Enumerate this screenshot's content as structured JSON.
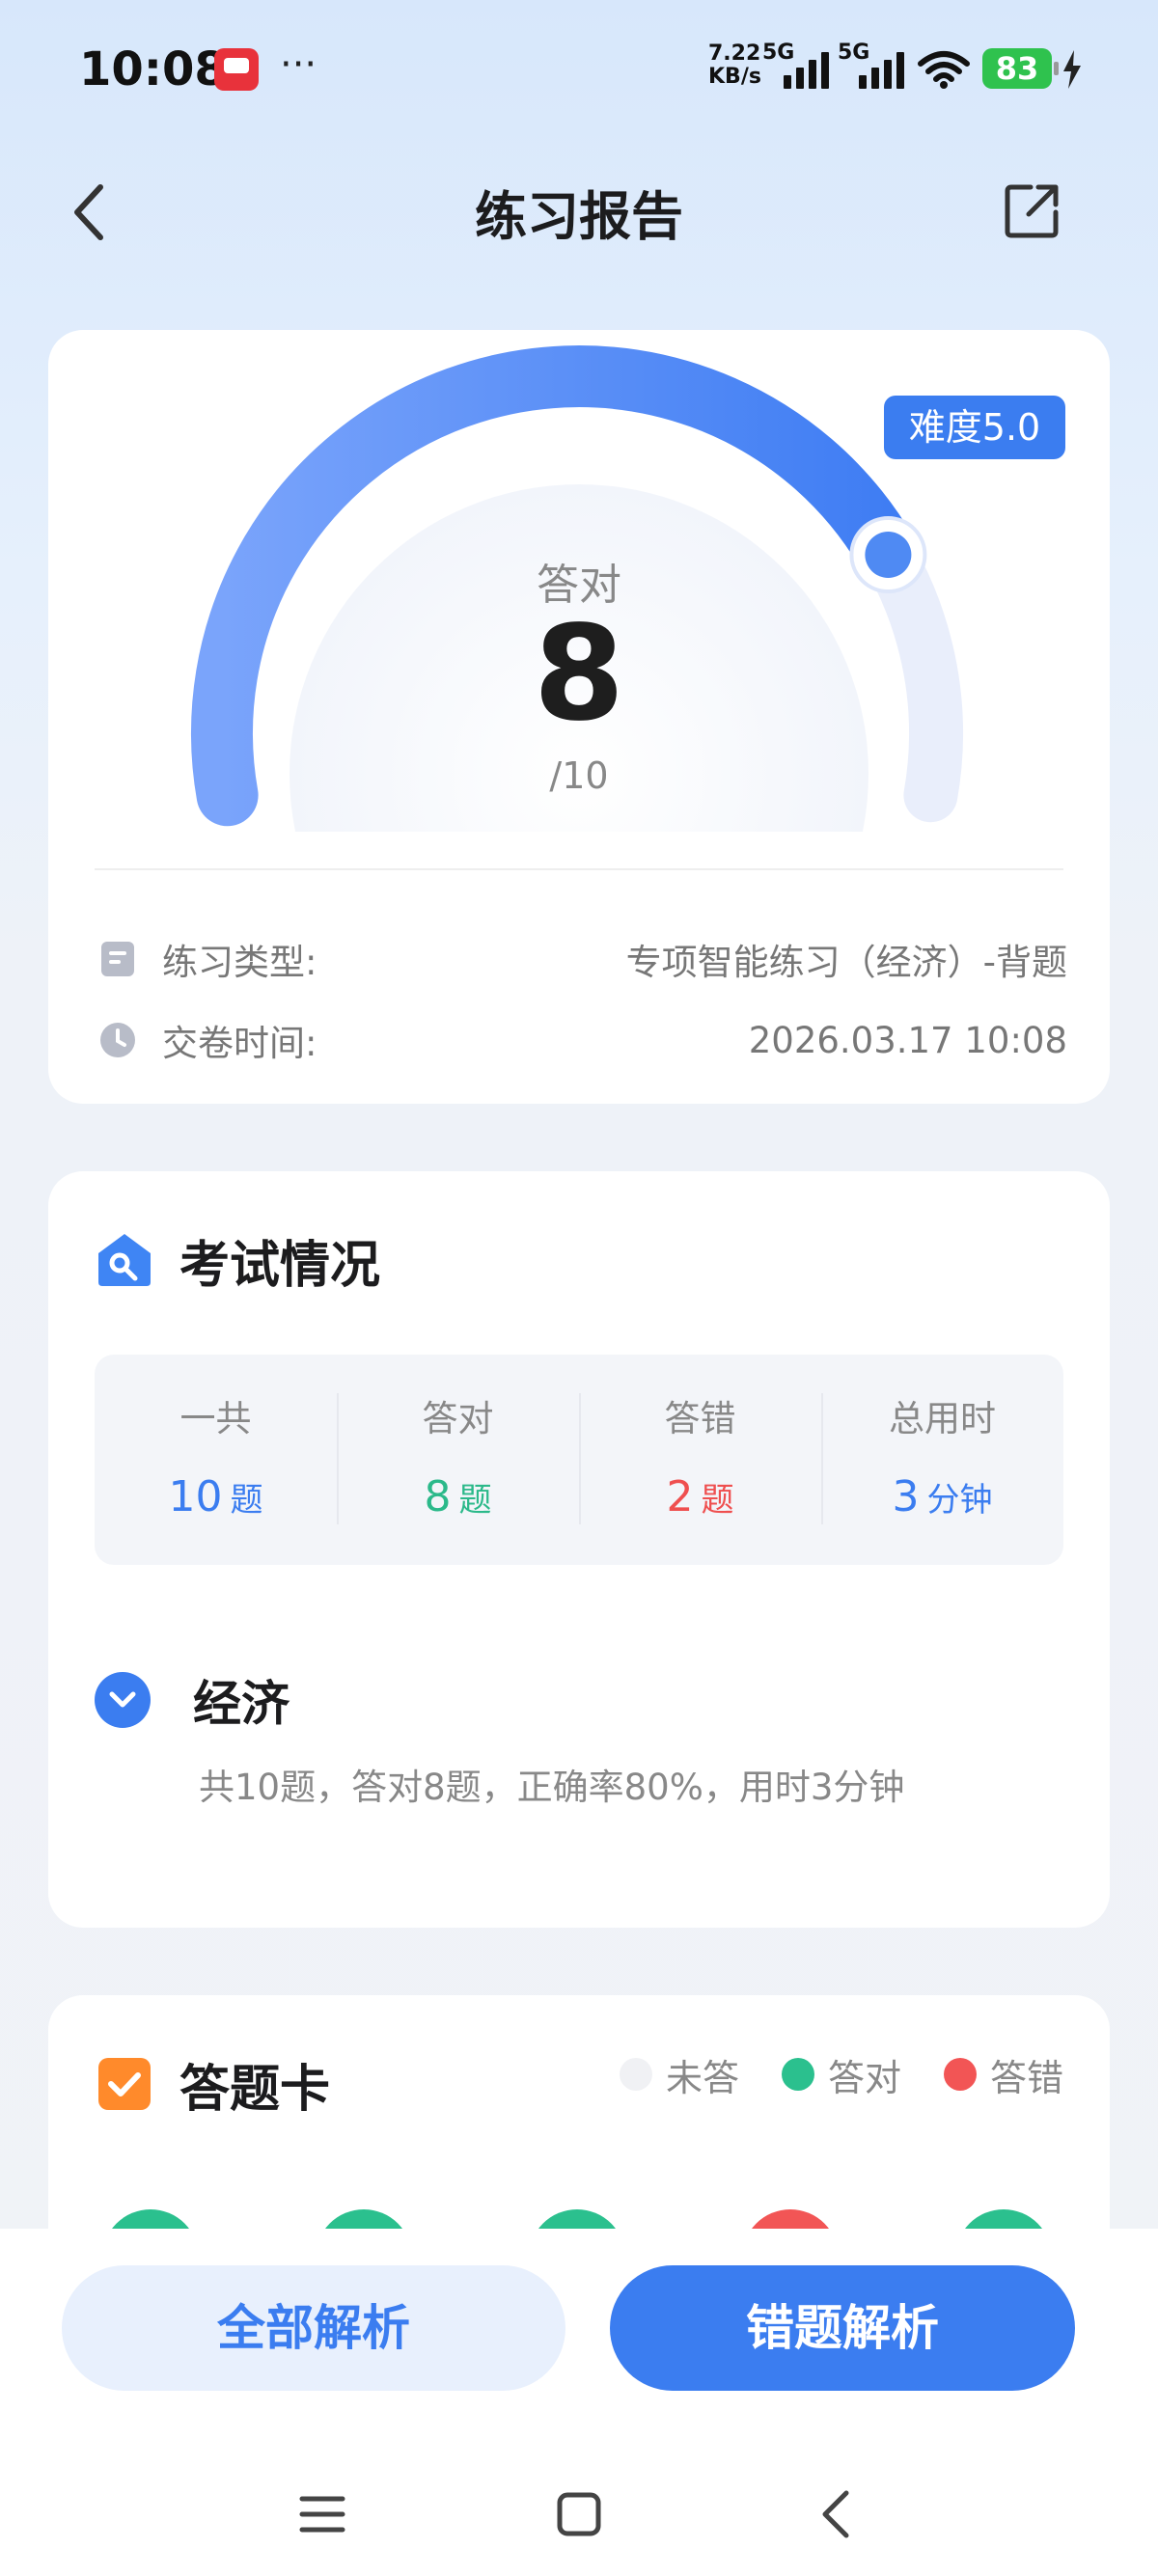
{
  "status_bar": {
    "time": "10:08",
    "more": "···",
    "net_speed_value": "7.22",
    "net_speed_unit": "KB/s",
    "network_1": "5G",
    "network_2": "5G",
    "battery": "83"
  },
  "header": {
    "title": "练习报告"
  },
  "score": {
    "difficulty": "难度5.0",
    "label": "答对",
    "correct": "8",
    "total": "/10",
    "progress": 0.8
  },
  "info": {
    "type_label": "练习类型:",
    "type_value": "专项智能练习（经济）-背题",
    "time_label": "交卷时间:",
    "time_value": "2026.03.17 10:08"
  },
  "exam": {
    "title": "考试情况",
    "stats": [
      {
        "label": "一共",
        "value": "10",
        "unit": "题"
      },
      {
        "label": "答对",
        "value": "8",
        "unit": "题"
      },
      {
        "label": "答错",
        "value": "2",
        "unit": "题"
      },
      {
        "label": "总用时",
        "value": "3",
        "unit": "分钟"
      }
    ],
    "subject": {
      "name": "经济",
      "summary": "共10题，答对8题，正确率80%，用时3分钟"
    }
  },
  "answer_card": {
    "title": "答题卡",
    "legend": [
      {
        "label": "未答",
        "color": "#f0f1f4"
      },
      {
        "label": "答对",
        "color": "#2bc08e"
      },
      {
        "label": "答错",
        "color": "#f25555"
      }
    ],
    "visible_results": [
      "correct",
      "correct",
      "correct",
      "wrong",
      "correct"
    ]
  },
  "actions": {
    "all_analysis": "全部解析",
    "wrong_analysis": "错题解析"
  },
  "colors": {
    "accent": "#3b7df0",
    "correct": "#2bb98a",
    "wrong": "#ef4f4f"
  }
}
